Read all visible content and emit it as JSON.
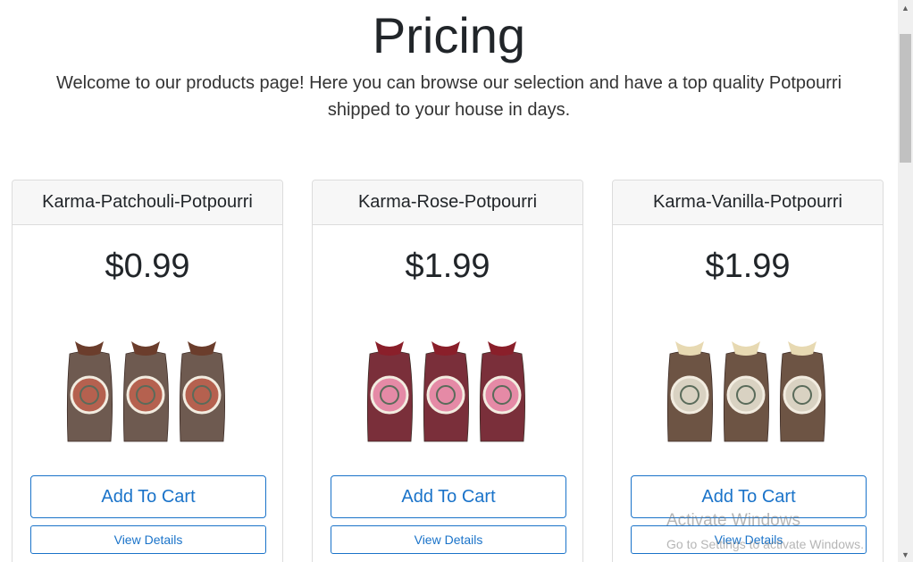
{
  "page": {
    "title": "Pricing",
    "lead": "Welcome to our products page! Here you can browse our selection and have a top quality Potpourri shipped to your house in days."
  },
  "products": [
    {
      "name": "Karma-Patchouli-Potpourri",
      "price": "$0.99",
      "add_label": "Add To Cart",
      "details_label": "View Details",
      "image": "patchouli-potpourri-bags",
      "bag_color": "#6e5a50",
      "label_color": "#b5614f",
      "tie_color": "#6b3d2c"
    },
    {
      "name": "Karma-Rose-Potpourri",
      "price": "$1.99",
      "add_label": "Add To Cart",
      "details_label": "View Details",
      "image": "rose-potpourri-bags",
      "bag_color": "#7a2f3a",
      "label_color": "#e58aa6",
      "tie_color": "#8a1f2a"
    },
    {
      "name": "Karma-Vanilla-Potpourri",
      "price": "$1.99",
      "add_label": "Add To Cart",
      "details_label": "View Details",
      "image": "vanilla-potpourri-bags",
      "bag_color": "#6d5444",
      "label_color": "#d9d2c2",
      "tie_color": "#e7d9b2"
    }
  ],
  "watermark": {
    "title": "Activate Windows",
    "subtitle": "Go to Settings to activate Windows."
  },
  "colors": {
    "accent": "#1a73c9",
    "header_bg": "#f7f7f7",
    "border": "#dcdcdc"
  }
}
